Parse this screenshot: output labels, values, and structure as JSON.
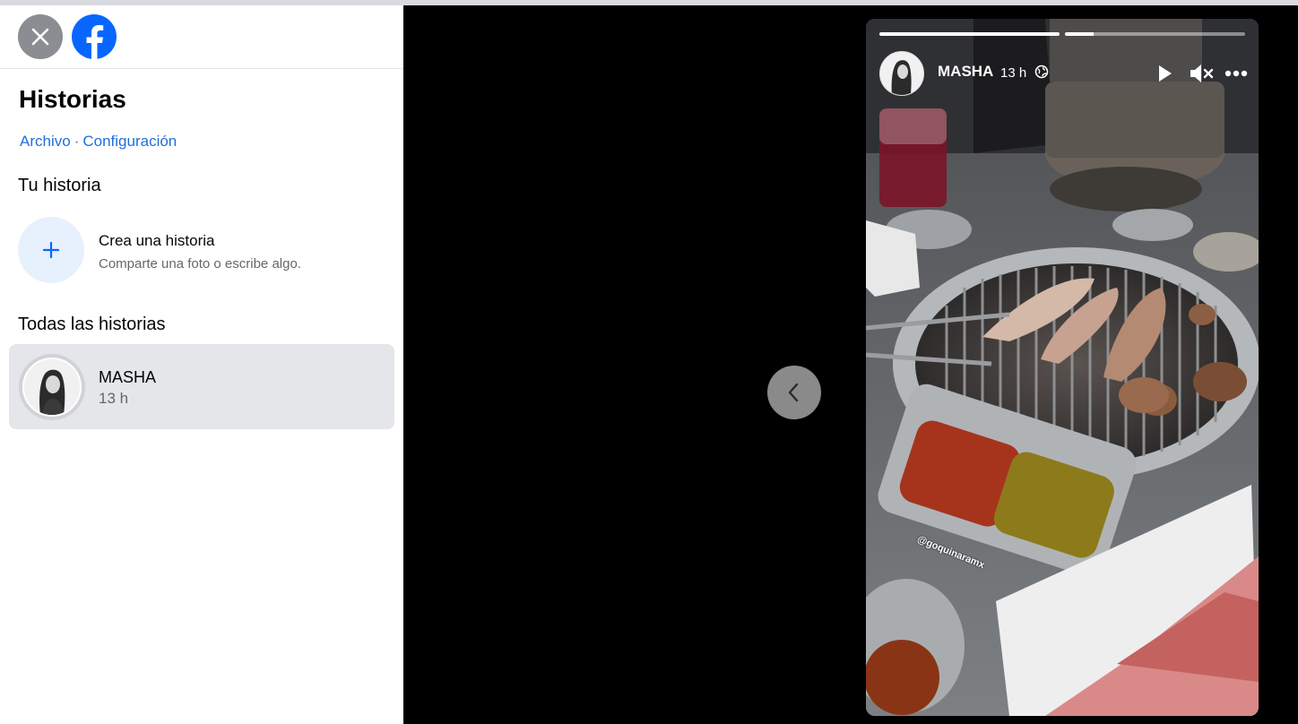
{
  "sidebar": {
    "title": "Historias",
    "links": {
      "archive": "Archivo",
      "separator": "·",
      "settings": "Configuración"
    },
    "your_story": {
      "heading": "Tu historia",
      "create_title": "Crea una historia",
      "create_subtitle": "Comparte una foto o escribe algo."
    },
    "all_stories": {
      "heading": "Todas las historias",
      "items": [
        {
          "name": "MASHA",
          "time": "13 h"
        }
      ]
    }
  },
  "story": {
    "author": "MASHA",
    "time": "13 h",
    "watermark": "@goquinaramx",
    "progress": [
      1.0,
      0.16
    ],
    "icons": [
      "globe-icon",
      "play-icon",
      "mute-icon",
      "more-icon"
    ]
  },
  "colors": {
    "link": "#216fdb",
    "facebook_blue": "#0866ff",
    "selected_row": "#e4e6e9"
  }
}
